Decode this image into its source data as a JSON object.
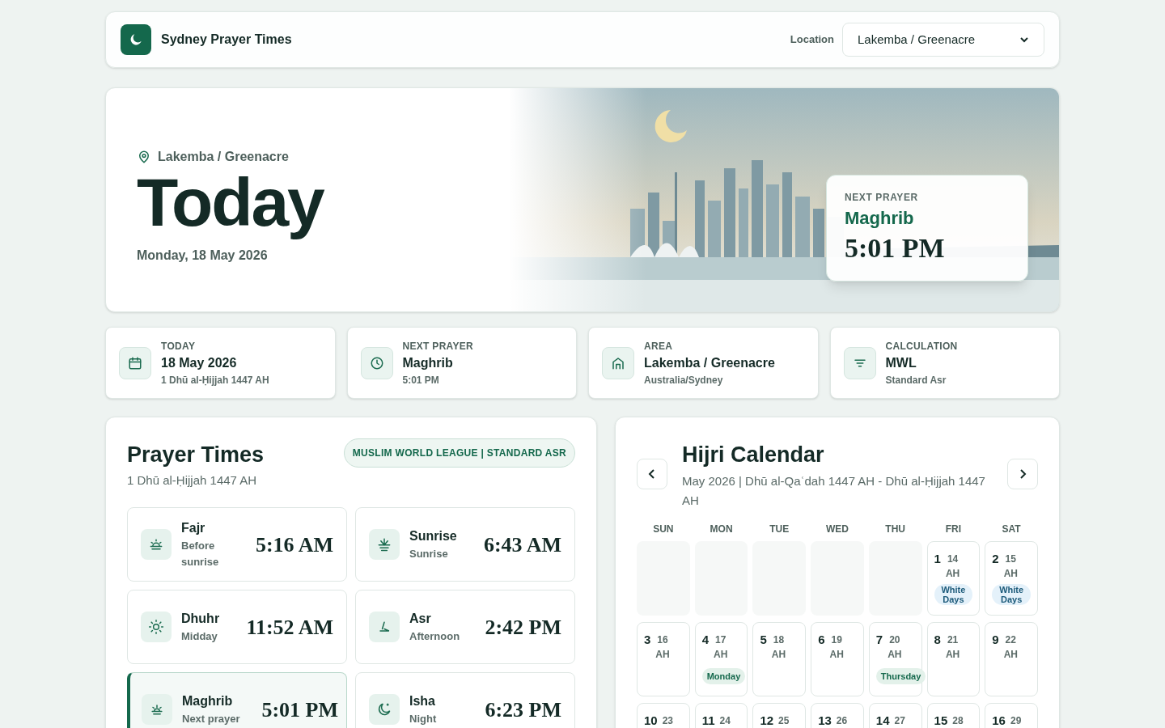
{
  "header": {
    "title": "Sydney Prayer Times",
    "location_label": "Location",
    "location_value": "Lakemba / Greenacre"
  },
  "hero": {
    "location": "Lakemba / Greenacre",
    "heading": "Today",
    "date": "Monday, 18 May 2026",
    "next": {
      "label": "NEXT PRAYER",
      "name": "Maghrib",
      "time": "5:01 PM"
    }
  },
  "stats": [
    {
      "label": "TODAY",
      "value": "18 May 2026",
      "sub": "1 Dhū al-Ḥijjah 1447 AH"
    },
    {
      "label": "NEXT PRAYER",
      "value": "Maghrib",
      "sub": "5:01 PM"
    },
    {
      "label": "AREA",
      "value": "Lakemba / Greenacre",
      "sub": "Australia/Sydney"
    },
    {
      "label": "CALCULATION",
      "value": "MWL",
      "sub": "Standard Asr"
    }
  ],
  "prayer_times": {
    "title": "Prayer Times",
    "subtitle": "1 Dhū al-Ḥijjah 1447 AH",
    "badge": "MUSLIM WORLD LEAGUE | STANDARD ASR",
    "prayers": [
      {
        "name": "Fajr",
        "note": "Before sunrise",
        "time": "5:16 AM",
        "selected": false
      },
      {
        "name": "Sunrise",
        "note": "Sunrise",
        "time": "6:43 AM",
        "selected": false
      },
      {
        "name": "Dhuhr",
        "note": "Midday",
        "time": "11:52 AM",
        "selected": false
      },
      {
        "name": "Asr",
        "note": "Afternoon",
        "time": "2:42 PM",
        "selected": false
      },
      {
        "name": "Maghrib",
        "note": "Next prayer",
        "time": "5:01 PM",
        "selected": true
      },
      {
        "name": "Isha",
        "note": "Night",
        "time": "6:23 PM",
        "selected": false
      }
    ]
  },
  "calendar": {
    "title": "Hijri Calendar",
    "subtitle": "May 2026 | Dhū al-Qaʿdah 1447 AH - Dhū al-Ḥijjah 1447 AH",
    "weekdays": [
      "SUN",
      "MON",
      "TUE",
      "WED",
      "THU",
      "FRI",
      "SAT"
    ],
    "weeks": [
      [
        {
          "kind": "empty"
        },
        {
          "kind": "empty"
        },
        {
          "kind": "empty"
        },
        {
          "kind": "empty"
        },
        {
          "kind": "empty"
        },
        {
          "kind": "day",
          "day": "1",
          "hijri": "14",
          "suffix": "AH",
          "tag": {
            "kind": "white",
            "text": "White Days"
          }
        },
        {
          "kind": "day",
          "day": "2",
          "hijri": "15",
          "suffix": "AH",
          "tag": {
            "kind": "white",
            "text": "White Days"
          }
        }
      ],
      [
        {
          "kind": "day",
          "day": "3",
          "hijri": "16",
          "suffix": "AH"
        },
        {
          "kind": "day",
          "day": "4",
          "hijri": "17",
          "suffix": "AH",
          "tag": {
            "kind": "fast",
            "text": "Monday"
          }
        },
        {
          "kind": "day",
          "day": "5",
          "hijri": "18",
          "suffix": "AH"
        },
        {
          "kind": "day",
          "day": "6",
          "hijri": "19",
          "suffix": "AH"
        },
        {
          "kind": "day",
          "day": "7",
          "hijri": "20",
          "suffix": "AH",
          "tag": {
            "kind": "fast",
            "text": "Thursday"
          }
        },
        {
          "kind": "day",
          "day": "8",
          "hijri": "21",
          "suffix": "AH"
        },
        {
          "kind": "day",
          "day": "9",
          "hijri": "22",
          "suffix": "AH"
        }
      ],
      [
        {
          "kind": "day",
          "day": "10",
          "hijri": "23"
        },
        {
          "kind": "day",
          "day": "11",
          "hijri": "24"
        },
        {
          "kind": "day",
          "day": "12",
          "hijri": "25"
        },
        {
          "kind": "day",
          "day": "13",
          "hijri": "26"
        },
        {
          "kind": "day",
          "day": "14",
          "hijri": "27"
        },
        {
          "kind": "day",
          "day": "15",
          "hijri": "28"
        },
        {
          "kind": "day",
          "day": "16",
          "hijri": "29"
        }
      ]
    ]
  }
}
